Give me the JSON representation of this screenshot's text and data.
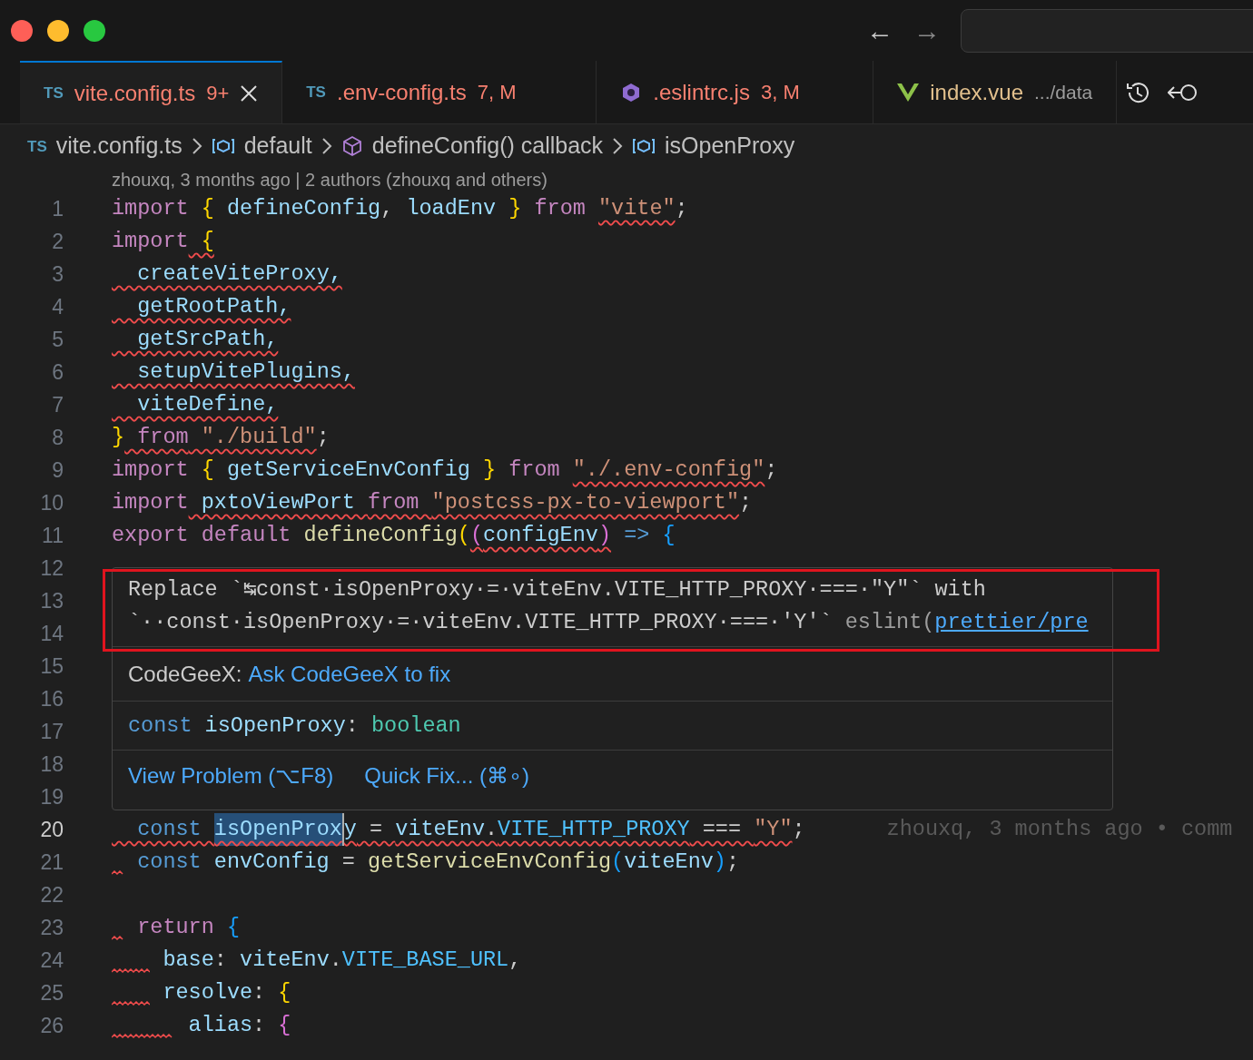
{
  "titlebar": {
    "nav": [
      "←",
      "→"
    ]
  },
  "tabs": [
    {
      "kind": "ts",
      "icon_text": "TS",
      "label": "vite.config.ts",
      "badge": "9+",
      "selected": true,
      "closable": true
    },
    {
      "kind": "ts",
      "icon_text": "TS",
      "label": ".env-config.ts",
      "badge": "7, M",
      "selected": false,
      "closable": false
    },
    {
      "kind": "eslint",
      "label": ".eslintrc.js",
      "badge": "3, M",
      "selected": false,
      "closable": false
    },
    {
      "kind": "vue",
      "label": "index.vue",
      "description": ".../data",
      "selected": false,
      "closable": false
    }
  ],
  "breadcrumb": [
    {
      "kind": "ts",
      "icon_text": "TS",
      "label": "vite.config.ts"
    },
    {
      "kind": "variable",
      "label": "default"
    },
    {
      "kind": "method",
      "label": "defineConfig() callback"
    },
    {
      "kind": "variable",
      "label": "isOpenProxy"
    }
  ],
  "blame": "zhouxq, 3 months ago | 2 authors (zhouxq and others)",
  "lines": [
    {
      "number": "1",
      "tokens": [
        {
          "text": "import",
          "kind": "kw"
        },
        {
          "text": " {",
          "kind": "b1"
        },
        {
          "text": " defineConfig",
          "kind": "var"
        },
        {
          "text": ", ",
          "kind": "p"
        },
        {
          "text": "loadEnv ",
          "kind": "var"
        },
        {
          "text": "}",
          "kind": "b1"
        },
        {
          "text": " from ",
          "kind": "kw"
        },
        {
          "text": "\"vite\"",
          "kind": "str",
          "err": true
        },
        {
          "text": ";",
          "kind": "p"
        }
      ]
    },
    {
      "number": "2",
      "tokens": [
        {
          "text": "import",
          "kind": "kw"
        },
        {
          "text": " {",
          "kind": "b1",
          "err": true
        }
      ]
    },
    {
      "number": "3",
      "tokens": [
        {
          "text": "  createViteProxy,",
          "kind": "var",
          "err": true
        }
      ]
    },
    {
      "number": "4",
      "tokens": [
        {
          "text": "  getRootPath,",
          "kind": "var",
          "err": true
        }
      ]
    },
    {
      "number": "5",
      "tokens": [
        {
          "text": "  getSrcPath,",
          "kind": "var",
          "err": true
        }
      ]
    },
    {
      "number": "6",
      "tokens": [
        {
          "text": "  setupVitePlugins,",
          "kind": "var",
          "err": true
        }
      ]
    },
    {
      "number": "7",
      "tokens": [
        {
          "text": "  viteDefine,",
          "kind": "var",
          "err": true
        }
      ]
    },
    {
      "number": "8",
      "tokens": [
        {
          "text": "}",
          "kind": "b1"
        },
        {
          "text": " from",
          "kind": "kw",
          "err": true
        },
        {
          "text": " \"./build\"",
          "kind": "str",
          "err": true
        },
        {
          "text": ";",
          "kind": "p"
        }
      ]
    },
    {
      "number": "9",
      "tokens": [
        {
          "text": "import",
          "kind": "kw"
        },
        {
          "text": " {",
          "kind": "b1"
        },
        {
          "text": " getServiceEnvConfig ",
          "kind": "var"
        },
        {
          "text": "}",
          "kind": "b1"
        },
        {
          "text": " from ",
          "kind": "kw"
        },
        {
          "text": "\"./.env-config\"",
          "kind": "str",
          "err": true
        },
        {
          "text": ";",
          "kind": "p"
        }
      ]
    },
    {
      "number": "10",
      "tokens": [
        {
          "text": "import",
          "kind": "kw"
        },
        {
          "text": " pxtoViewPort ",
          "kind": "var",
          "err": true
        },
        {
          "text": "from ",
          "kind": "kw",
          "err": true
        },
        {
          "text": "\"postcss-px-to-viewport\"",
          "kind": "str",
          "err": true
        },
        {
          "text": ";",
          "kind": "p"
        }
      ]
    },
    {
      "number": "11",
      "tokens": [
        {
          "text": "export ",
          "kind": "kw"
        },
        {
          "text": "default ",
          "kind": "kw"
        },
        {
          "text": "defineConfig",
          "kind": "fn"
        },
        {
          "text": "(",
          "kind": "b1"
        },
        {
          "text": "(",
          "kind": "b2",
          "err": true
        },
        {
          "text": "configEnv",
          "kind": "var",
          "err": true
        },
        {
          "text": ")",
          "kind": "b2",
          "err": true
        },
        {
          "text": " =>",
          "kind": "storage"
        },
        {
          "text": " {",
          "kind": "b3"
        }
      ]
    },
    {
      "number": "12"
    },
    {
      "number": "13"
    },
    {
      "number": "14"
    },
    {
      "number": "15"
    },
    {
      "number": "16"
    },
    {
      "number": "17"
    },
    {
      "number": "18"
    },
    {
      "number": "19"
    },
    {
      "number": "20",
      "current": true,
      "tokens": [
        {
          "text": "  const ",
          "kind": "storage",
          "err": true
        },
        {
          "text": "isOpenProx",
          "kind": "var",
          "err": true,
          "highlight": true,
          "caret": true
        },
        {
          "text": "y",
          "kind": "var",
          "err": true
        },
        {
          "text": " = ",
          "kind": "p",
          "err": true
        },
        {
          "text": "viteEnv",
          "kind": "var",
          "err": true
        },
        {
          "text": ".",
          "kind": "p",
          "err": true
        },
        {
          "text": "VITE_HTTP_PROXY",
          "kind": "const",
          "err": true
        },
        {
          "text": " === ",
          "kind": "p",
          "err": true
        },
        {
          "text": "\"Y\"",
          "kind": "str",
          "err": true
        },
        {
          "text": ";",
          "kind": "p"
        }
      ],
      "inline_blame": "zhouxq, 3 months ago • comm"
    },
    {
      "number": "21",
      "indent_squiggle": true,
      "tokens": [
        {
          "text": "  const",
          "kind": "storage"
        },
        {
          "text": " envConfig ",
          "kind": "var"
        },
        {
          "text": "= ",
          "kind": "p"
        },
        {
          "text": "getServiceEnvConfig",
          "kind": "fn"
        },
        {
          "text": "(",
          "kind": "b3"
        },
        {
          "text": "viteEnv",
          "kind": "var"
        },
        {
          "text": ")",
          "kind": "b3"
        },
        {
          "text": ";",
          "kind": "p"
        }
      ]
    },
    {
      "number": "22"
    },
    {
      "number": "23",
      "indent_squiggle": true,
      "tokens": [
        {
          "text": "  return",
          "kind": "kw"
        },
        {
          "text": " {",
          "kind": "b3"
        }
      ]
    },
    {
      "number": "24",
      "indent_squiggle": true,
      "tokens": [
        {
          "text": "    base",
          "kind": "var"
        },
        {
          "text": ": ",
          "kind": "p"
        },
        {
          "text": "viteEnv",
          "kind": "var"
        },
        {
          "text": ".",
          "kind": "p"
        },
        {
          "text": "VITE_BASE_URL",
          "kind": "const"
        },
        {
          "text": ",",
          "kind": "p"
        }
      ]
    },
    {
      "number": "25",
      "indent_squiggle": true,
      "tokens": [
        {
          "text": "    resolve",
          "kind": "var"
        },
        {
          "text": ": ",
          "kind": "p"
        },
        {
          "text": "{",
          "kind": "b1"
        }
      ]
    },
    {
      "number": "26",
      "indent_squiggle": true,
      "tokens": [
        {
          "text": "      alias",
          "kind": "var"
        },
        {
          "text": ": ",
          "kind": "p"
        },
        {
          "text": "{",
          "kind": "b2"
        }
      ]
    }
  ],
  "hover": {
    "message_lines": [
      "Replace `↹const·isOpenProxy·=·viteEnv.VITE_HTTP_PROXY·===·\"Y\"` with",
      "`··const·isOpenProxy·=·viteEnv.VITE_HTTP_PROXY·===·'Y'`"
    ],
    "source": "eslint(",
    "source_link": "prettier/pre",
    "assistant_label": "CodeGeeX:",
    "assistant_link": "Ask CodeGeeX to fix",
    "signature": [
      {
        "text": "const",
        "kind": "storage"
      },
      {
        "text": " isOpenProxy",
        "kind": "var"
      },
      {
        "text": ": ",
        "kind": "p"
      },
      {
        "text": "boolean",
        "kind": "type"
      }
    ],
    "actions": [
      "View Problem (⌥F8)",
      "Quick Fix... (⌘∘)"
    ]
  }
}
